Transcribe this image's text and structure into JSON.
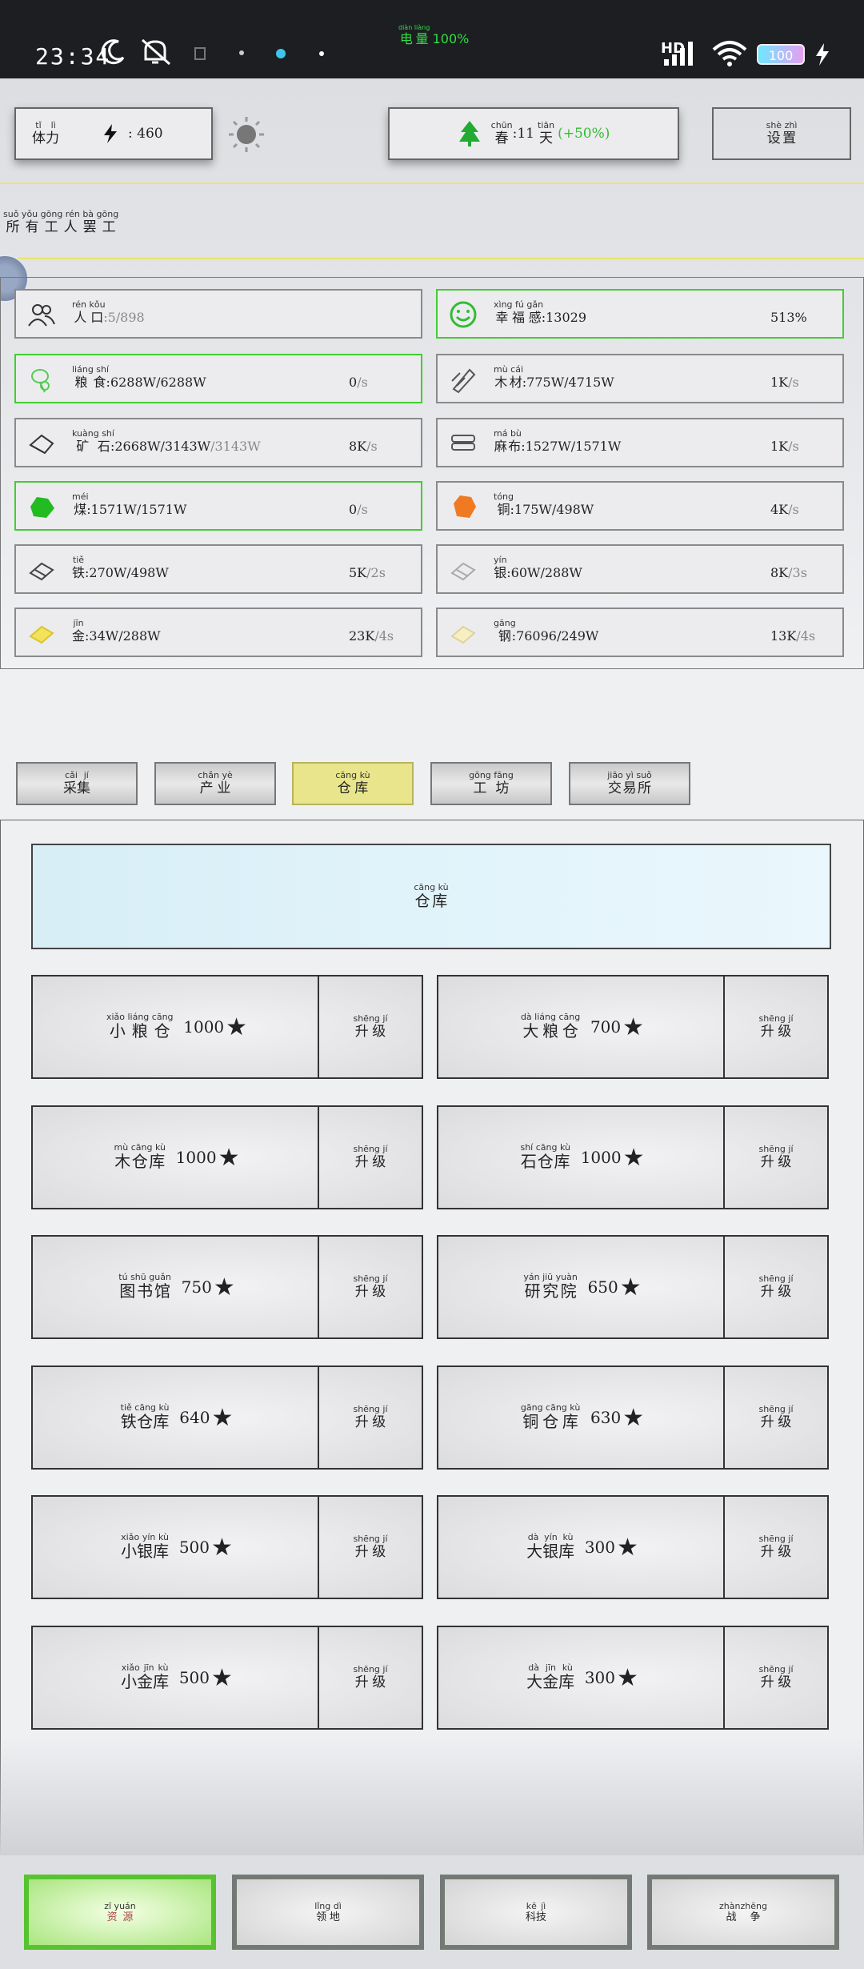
{
  "status_bar": {
    "time": "23:34",
    "battery_label": "电量",
    "battery_label_ruby": "diàn liàng",
    "battery_value": "100%",
    "network": "HD",
    "battery_icon_text": "100",
    "icons": [
      "moon-icon",
      "mute-icon",
      "sim-icon",
      "dot-icon",
      "dot-icon",
      "dot-icon",
      "signal-icon",
      "wifi-icon",
      "battery-icon",
      "charging-icon"
    ]
  },
  "top_bar": {
    "stamina": {
      "label": "体力",
      "ruby": "tǐ lì",
      "value": ": 460"
    },
    "season": {
      "label": "春",
      "ruby": "chūn",
      "days": ":11",
      "days_unit": "天",
      "days_unit_ruby": "tiān",
      "bonus": "(+50%)"
    },
    "settings": {
      "label": "设置",
      "ruby": "shè zhì"
    }
  },
  "notice": {
    "text": "所有工人罢工",
    "ruby": "suǒ yǒu gōng rén bà gōng"
  },
  "resources": {
    "population": {
      "label": "人口",
      "ruby": "rén kǒu",
      "value": ":5/898"
    },
    "happiness": {
      "label": "幸福感",
      "ruby": "xìng fú gǎn",
      "value": ":13029",
      "rate": "513%"
    },
    "grain": {
      "label": "粮食",
      "ruby": "liáng shí",
      "value": ":6288W/6288W",
      "rate": "0",
      "unit": "/s"
    },
    "wood": {
      "label": "木材",
      "ruby": "mù cái",
      "value": ":775W/4715W",
      "rate": "1K",
      "unit": "/s"
    },
    "ore": {
      "label": "矿石",
      "ruby": "kuàng shí",
      "value": ":2668W/3143W",
      "rate": "8K",
      "unit": "/s"
    },
    "linen": {
      "label": "麻布",
      "ruby": "má bù",
      "value": ":1527W/1571W",
      "rate": "1K",
      "unit": "/s"
    },
    "coal": {
      "label": "煤",
      "ruby": "méi",
      "value": ":1571W/1571W",
      "rate": "0",
      "unit": "/s"
    },
    "copper": {
      "label": "铜",
      "ruby": "tóng",
      "value": ":175W/498W",
      "rate": "4K",
      "unit": "/s"
    },
    "iron": {
      "label": "铁",
      "ruby": "tiě",
      "value": ":270W/498W",
      "rate": "5K",
      "unit": "/2s"
    },
    "silver": {
      "label": "银",
      "ruby": "yín",
      "value": ":60W/288W",
      "rate": "8K",
      "unit": "/3s"
    },
    "gold": {
      "label": "金",
      "ruby": "jīn",
      "value": ":34W/288W",
      "rate": "23K",
      "unit": "/4s"
    },
    "steel": {
      "label": "钢",
      "ruby": "gāng",
      "value": ":76096/249W",
      "rate": "13K",
      "unit": "/4s"
    }
  },
  "tabs": [
    {
      "label": "采集",
      "ruby": "cǎi jí"
    },
    {
      "label": "产业",
      "ruby": "chǎn yè"
    },
    {
      "label": "仓库",
      "ruby": "cāng kù",
      "active": true
    },
    {
      "label": "工坊",
      "ruby": "gōng fāng"
    },
    {
      "label": "交易所",
      "ruby": "jiāo yì suǒ"
    }
  ],
  "section": {
    "title": "仓库",
    "ruby": "cāng kù"
  },
  "upgrade": {
    "label": "升级",
    "ruby": "shēng jí"
  },
  "buildings": [
    {
      "name": "小粮仓",
      "ruby": "xiǎo liáng cāng",
      "value": "1000"
    },
    {
      "name": "大粮仓",
      "ruby": "dà liáng cāng",
      "value": "700"
    },
    {
      "name": "木仓库",
      "ruby": "mù cāng kù",
      "value": "1000"
    },
    {
      "name": "石仓库",
      "ruby": "shí cāng kù",
      "value": "1000"
    },
    {
      "name": "图书馆",
      "ruby": "tú shū guǎn",
      "value": "750"
    },
    {
      "name": "研究院",
      "ruby": "yán jiū yuàn",
      "value": "650"
    },
    {
      "name": "铁仓库",
      "ruby": "tiě cāng kù",
      "value": "640"
    },
    {
      "name": "铜仓库",
      "ruby": "gāng cāng kù",
      "value": "630"
    },
    {
      "name": "小银库",
      "ruby": "xiǎo yín kù",
      "value": "500"
    },
    {
      "name": "大银库",
      "ruby": "dà yín kù",
      "value": "300"
    },
    {
      "name": "小金库",
      "ruby": "xiǎo jīn kù",
      "value": "500"
    },
    {
      "name": "大金库",
      "ruby": "dà jīn kù",
      "value": "300"
    }
  ],
  "star": "★",
  "nav": [
    {
      "label": "资源",
      "ruby": "zī yuán",
      "active": true
    },
    {
      "label": "领地",
      "ruby": "lǐng dì"
    },
    {
      "label": "科技",
      "ruby": "kē jì"
    },
    {
      "label": "战争",
      "ruby": "zhànzhēng"
    }
  ]
}
